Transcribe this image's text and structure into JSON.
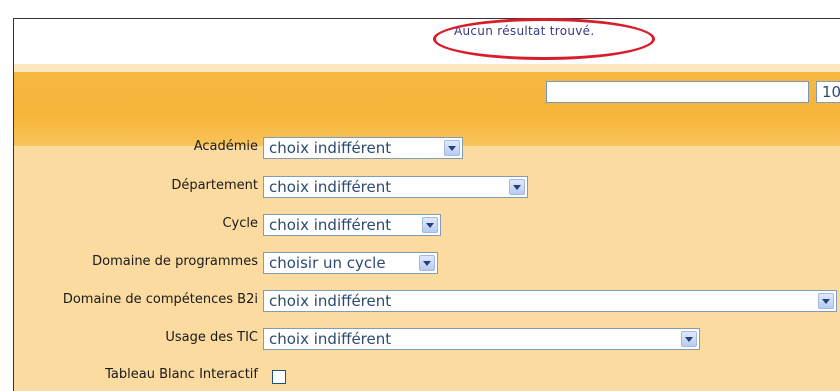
{
  "results": {
    "message": "Aucun résultat trouvé."
  },
  "toolbar": {
    "search_value": "",
    "page_size": "10"
  },
  "form": {
    "academie": {
      "label": "Académie",
      "value": "choix indifférent"
    },
    "departement": {
      "label": "Département",
      "value": "choix indifférent"
    },
    "cycle": {
      "label": "Cycle",
      "value": "choix indifférent"
    },
    "domaine_programmes": {
      "label": "Domaine de programmes",
      "value": "choisir un cycle"
    },
    "domaine_competences": {
      "label": "Domaine de compétences B2i",
      "value": "choix indifférent"
    },
    "usage_tic": {
      "label": "Usage des TIC",
      "value": "choix indifférent"
    },
    "tbi": {
      "label": "Tableau Blanc Interactif",
      "checked": false
    }
  },
  "colors": {
    "highlight": "#d81e2a",
    "toolbar": "#f6b53a",
    "form_bg": "#fbdba0"
  }
}
